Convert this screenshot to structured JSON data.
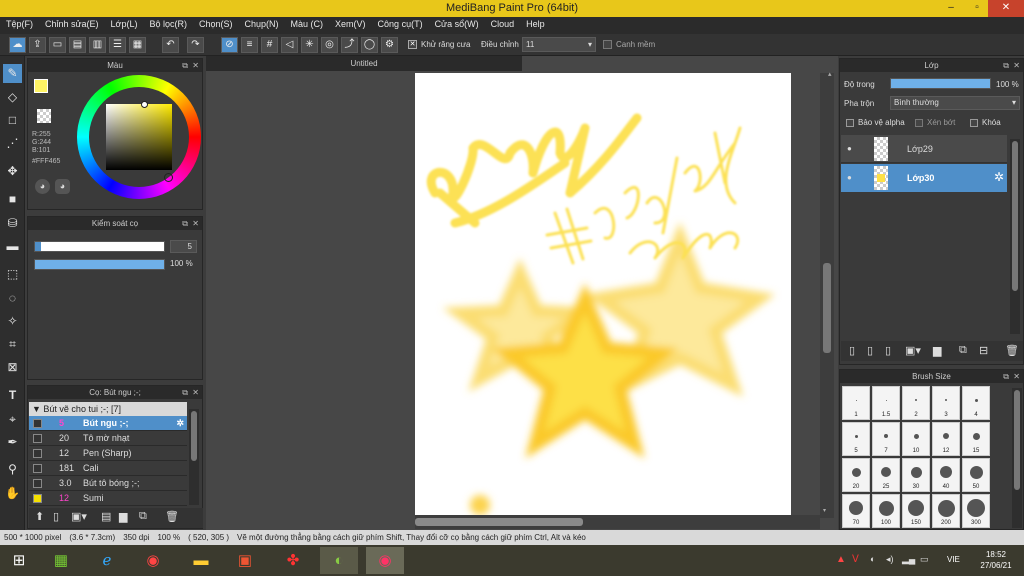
{
  "titlebar": {
    "title": "MediBang Paint Pro (64bit)",
    "minimize": "–",
    "restore": "▫",
    "close": "✕",
    "accent": "#e8c71a"
  },
  "menu": [
    "Tệp(F)",
    "Chỉnh sửa(E)",
    "Lớp(L)",
    "Bộ lọc(R)",
    "Chọn(S)",
    "Chụp(N)",
    "Màu (C)",
    "Xem(V)",
    "Công cụ(T)",
    "Cửa sổ(W)",
    "Cloud",
    "Help"
  ],
  "toolbar": {
    "antialias_label": "Khử răng cưa",
    "adjust_label": "Điều chỉnh",
    "adjust_value": "11",
    "snap_label": "Canh mềm"
  },
  "color_panel": {
    "title": "Màu",
    "r": "R:255",
    "g": "G:244",
    "b": "B:101",
    "hex": "#FFF465",
    "fg_color": "#fff465"
  },
  "brush_control": {
    "title": "Kiểm soát cọ",
    "size_value": "5",
    "opacity_value": "100 %",
    "opacity_fraction": 1.0,
    "size_fraction": 0.05
  },
  "brush_panel": {
    "title": "Cọ: Bút ngu ;-;",
    "group": "Bút vẽ cho tui ;-; [7]",
    "items": [
      {
        "size": "5",
        "name": "Bút ngu ;-;",
        "selected": true,
        "color": "#333"
      },
      {
        "size": "20",
        "name": "Tô mờ nhạt",
        "selected": false,
        "color": "#333"
      },
      {
        "size": "12",
        "name": "Pen (Sharp)",
        "selected": false,
        "color": "#333"
      },
      {
        "size": "181",
        "name": "Cali",
        "selected": false,
        "color": "#333"
      },
      {
        "size": "3.0",
        "name": "Bút tô bóng ;-;",
        "selected": false,
        "color": "#333"
      },
      {
        "size": "12",
        "name": "Sumi",
        "selected": false,
        "color": "#f5e000"
      }
    ]
  },
  "document": {
    "tab_title": "Untitled"
  },
  "layer_panel": {
    "title": "Lớp",
    "opacity_label": "Độ trong",
    "opacity_value": "100 %",
    "blend_label": "Pha trộn",
    "blend_value": "Bình thường",
    "protect_alpha": "Bảo vệ alpha",
    "clipping": "Xén bớt",
    "lock": "Khóa",
    "layers": [
      {
        "name": "Lớp29",
        "selected": false
      },
      {
        "name": "Lớp30",
        "selected": true
      }
    ]
  },
  "brush_size": {
    "title": "Brush Size",
    "sizes": [
      "1",
      "1.5",
      "2",
      "3",
      "4",
      "5",
      "7",
      "10",
      "12",
      "15",
      "20",
      "25",
      "30",
      "40",
      "50",
      "70",
      "100",
      "150",
      "200",
      "300"
    ]
  },
  "status": {
    "dimensions": "500 * 1000 pixel",
    "physical": "(3.6 * 7.3cm)",
    "dpi": "350 dpi",
    "zoom": "100 %",
    "cursor": "( 520, 305 )",
    "hint": "Vẽ một đường thẳng bằng cách giữ phím Shift, Thay đổi cỡ cọ bằng cách giữ phím Ctrl, Alt và kéo"
  },
  "taskbar": {
    "lang": "VIE",
    "time": "18:52",
    "date": "27/06/21"
  }
}
